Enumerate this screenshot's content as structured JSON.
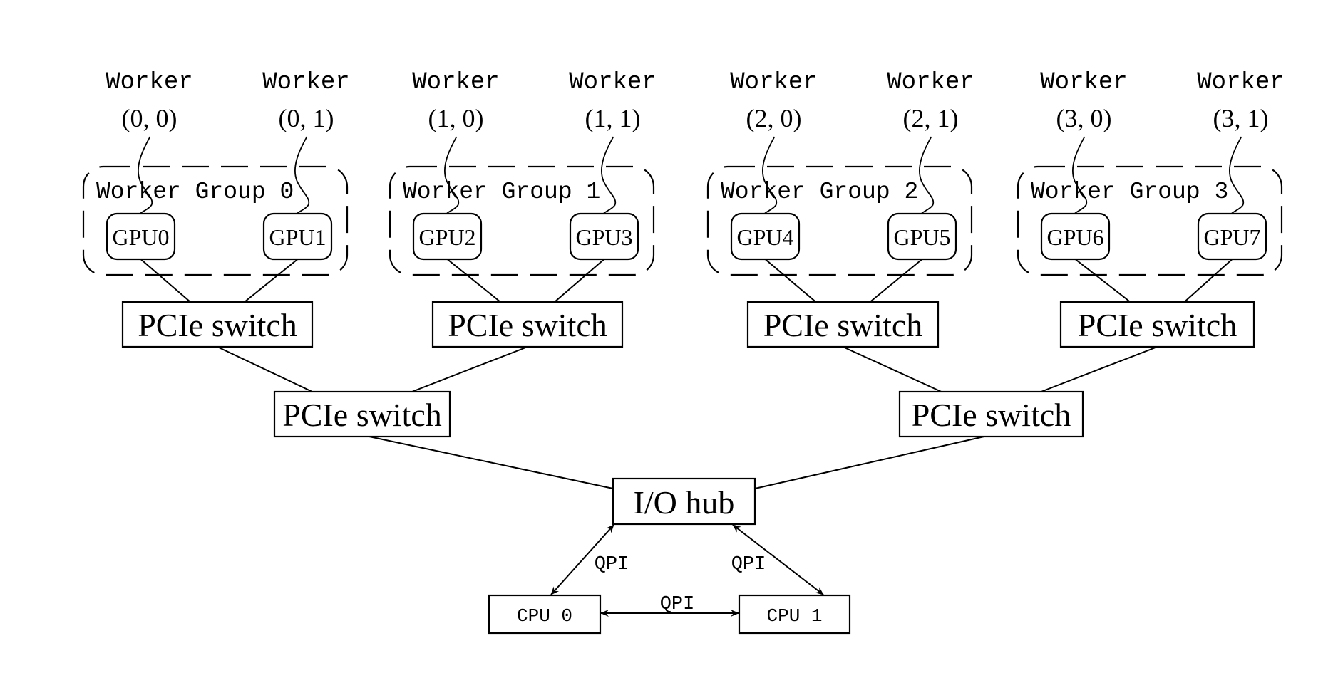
{
  "diagram": {
    "workers": [
      {
        "title": "Worker",
        "coord": "(0, 0)",
        "gpu": "GPU0"
      },
      {
        "title": "Worker",
        "coord": "(0, 1)",
        "gpu": "GPU1"
      },
      {
        "title": "Worker",
        "coord": "(1, 0)",
        "gpu": "GPU2"
      },
      {
        "title": "Worker",
        "coord": "(1, 1)",
        "gpu": "GPU3"
      },
      {
        "title": "Worker",
        "coord": "(2, 0)",
        "gpu": "GPU4"
      },
      {
        "title": "Worker",
        "coord": "(2, 1)",
        "gpu": "GPU5"
      },
      {
        "title": "Worker",
        "coord": "(3, 0)",
        "gpu": "GPU6"
      },
      {
        "title": "Worker",
        "coord": "(3, 1)",
        "gpu": "GPU7"
      }
    ],
    "groups": [
      {
        "label": "Worker Group 0"
      },
      {
        "label": "Worker Group 1"
      },
      {
        "label": "Worker Group 2"
      },
      {
        "label": "Worker Group 3"
      }
    ],
    "level1_switches": [
      "PCIe switch",
      "PCIe switch",
      "PCIe switch",
      "PCIe switch"
    ],
    "level2_switches": [
      "PCIe switch",
      "PCIe switch"
    ],
    "io_hub": "I/O hub",
    "cpus": [
      "CPU 0",
      "CPU 1"
    ],
    "links": {
      "cpu0_iohub": "QPI",
      "cpu1_iohub": "QPI",
      "cpu0_cpu1": "QPI"
    },
    "colors": {
      "stroke": "#000000",
      "background": "#ffffff"
    }
  }
}
